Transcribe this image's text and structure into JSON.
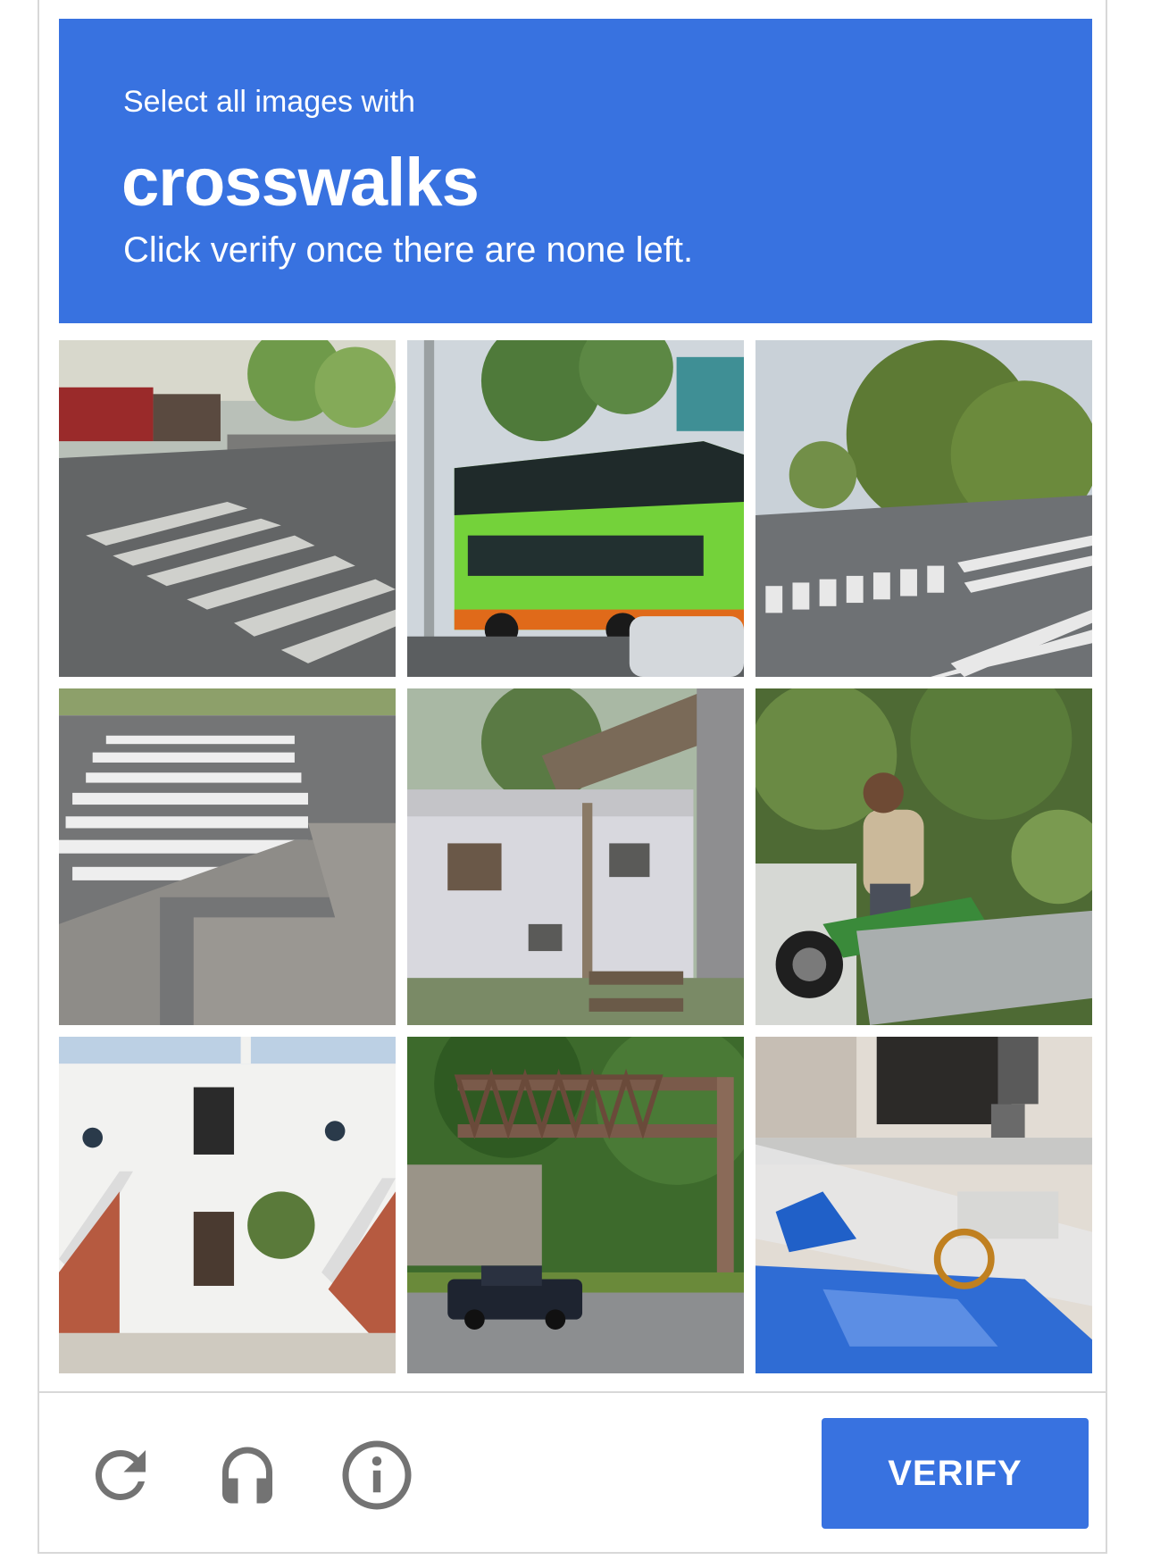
{
  "header": {
    "prompt": "Select all images with",
    "target": "crosswalks",
    "instruction": "Click verify once there are none left."
  },
  "tiles": [
    {
      "name": "street-crosswalk-cafe"
    },
    {
      "name": "green-double-decker-bus"
    },
    {
      "name": "intersection-crosswalk-trees"
    },
    {
      "name": "crosswalk-curb-corner"
    },
    {
      "name": "house-with-awning"
    },
    {
      "name": "man-on-motorcycle"
    },
    {
      "name": "white-building-stairs"
    },
    {
      "name": "road-sign-gantry-truck"
    },
    {
      "name": "house-blue-tarp-fence"
    }
  ],
  "footer": {
    "verify_label": "VERIFY"
  },
  "colors": {
    "accent": "#3872e0",
    "icon": "#737373"
  }
}
